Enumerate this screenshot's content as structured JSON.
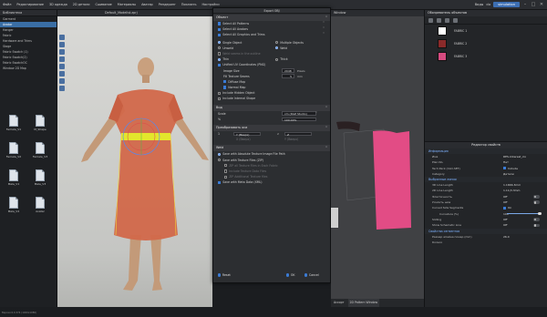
{
  "menubar": {
    "items": [
      "Файл",
      "Редактирование",
      "3D одежда",
      "2D детали",
      "Сшивание",
      "Материалы",
      "Аватар",
      "Рендеринг",
      "Показать",
      "Настройки"
    ],
    "right_chip": "Виды",
    "brand": "simulation",
    "user": "clo"
  },
  "library": {
    "tab": "Библиотека",
    "tree": [
      "Garment",
      "Avatar",
      "Hanger",
      "Fabric",
      "Hardware and Trims",
      "Stage",
      "Fabric Swatch (1)",
      "Fabric Swatch(2)",
      "Fabric SwatchOC",
      "Window 2D Map"
    ],
    "selected_index": 1,
    "files": [
      "Female_V1",
      "Female_V2",
      "Male_V1",
      "Male_V2",
      "M_Shape",
      "Female_V3",
      "Male_V3",
      "Avatar"
    ],
    "status": "Версия 6.0.374 (1920x1080)"
  },
  "viewport": {
    "tab": "Default_Modelist.zprj",
    "colors": {
      "bg": "#d0d0cd",
      "dress": "#d2684a",
      "belt": "#e3e62c",
      "skin": "#c9a07e"
    }
  },
  "dialog": {
    "title": "Export OBJ",
    "sections": {
      "object": "Объект",
      "scale": "Вид",
      "transform": "Преобразовать оси",
      "weld": "Weld"
    },
    "select_rows": [
      "Select All Patterns",
      "Select All Avatars",
      "Select All Graphics and Trims"
    ],
    "single_object": "Single Object",
    "multiple_objects": "Multiple Objects",
    "unweld": "Unweld",
    "weld": "Weld",
    "weld_hint": "Weld seams in the outline",
    "thin": "Thin",
    "thick": "Thick",
    "unified_uv": "Unified UV Coordinates (PNG)",
    "image_size_label": "Image Size",
    "image_size_value": "2048",
    "image_size_unit": "Pixels",
    "fill_texture_label": "Fill Texture Seams",
    "fill_texture_value": "5",
    "fill_texture_unit": "mm",
    "diffuse_map": "Diffuse Map",
    "normal_map": "Normal Map",
    "include_hidden": "Include Hidden Object",
    "include_internal": "Include Internal Shape",
    "scale_label": "Scale",
    "scale_value": "cm (DAZ Studio)",
    "percent_label": "%",
    "percent_value": "100.00%",
    "axis_from": "Y (Вверх)",
    "axis_to": "Z",
    "axis_from_hint": "X (Вверх)",
    "axis_to_hint": "Y (Вверх)",
    "axis_prefix": "1",
    "axis_prefix2": "2",
    "save_absolute": "Save with Absolute Texture Image File Path",
    "save_files": "Save with Texture Files (ZIP)",
    "save_files_opt1": "ZIP all Texture Files in Each Fabric",
    "save_files_opt2": "Include Texture Data Files",
    "save_files_opt3": "ZIP Additional Texture files",
    "save_meta": "Save with Meta Data (XML)",
    "reset": "Reset",
    "ok": "OK",
    "cancel": "Cancel"
  },
  "win2d": {
    "tab": "Window",
    "footer_tabs": [
      "Ассорт",
      "2D Pattern Window"
    ],
    "colors": {
      "pattern": "#e24c85",
      "bg": "#404144"
    }
  },
  "object_browser": {
    "tab": "Обозреватель объектов",
    "fabrics": [
      {
        "name": "FABRIC 1",
        "color": "#ffffff"
      },
      {
        "name": "FABRIC 2",
        "color": "#8a2a2a"
      },
      {
        "name": "FABRIC 3",
        "color": "#d64b80"
      }
    ]
  },
  "property_editor": {
    "title": "Редактор свойств",
    "info_section": "Информация",
    "rows_info": [
      {
        "label": "Имя",
        "value": "RES-linterest_clo"
      },
      {
        "label": "Plan No.",
        "value": "Нет"
      },
      {
        "label": "Tech Pack (CLO-SET)",
        "value": "Include"
      },
      {
        "label": "Category",
        "value": "Детали"
      }
    ],
    "line_section": "Выбранные линии",
    "rows_line": [
      {
        "label": "3D Line Length",
        "value": "1.1666.3mm"
      },
      {
        "label": "2D Line Length",
        "value": "1.11(3.3mm"
      },
      {
        "label": "Эластичность",
        "value": "Off"
      },
      {
        "label": "Усилить шов",
        "value": "Off"
      },
      {
        "label": "Curved Side Segments",
        "value": "On"
      },
      {
        "label": "Curvature (%)",
        "value": "100",
        "fraction": 1.0
      },
      {
        "label": "Sliding",
        "value": "Off"
      },
      {
        "label": "Show Schematic Line",
        "value": "Off"
      }
    ],
    "seam_section": "Свойства сегментов",
    "rows_seam": [
      {
        "label": "Размер апайна помер (mm)",
        "value": "26.0"
      },
      {
        "label": "Колесо",
        "value": ""
      }
    ]
  }
}
